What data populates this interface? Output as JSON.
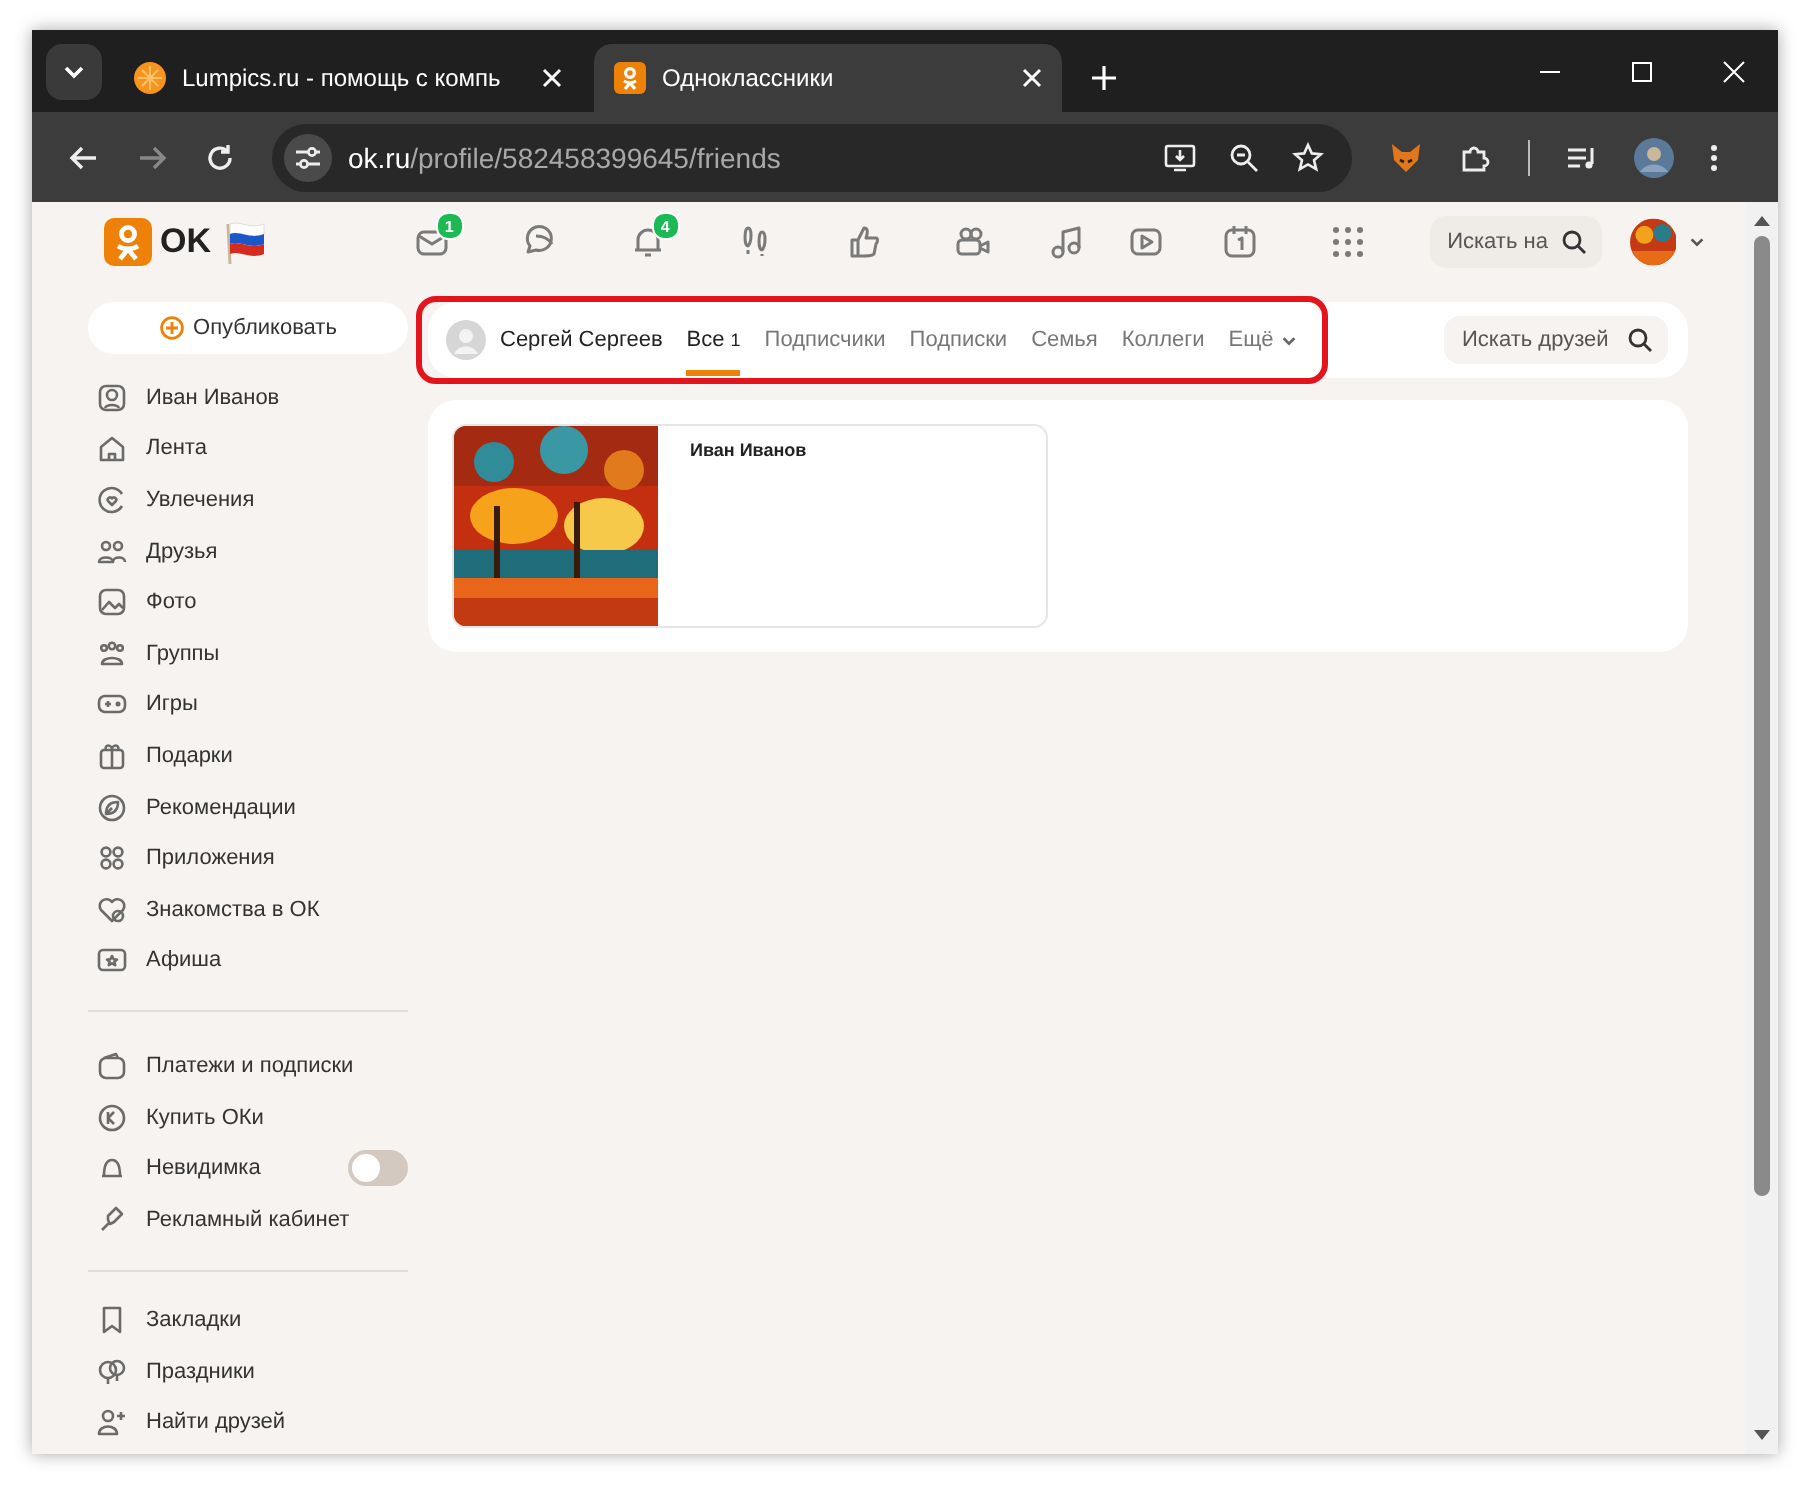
{
  "browser": {
    "tabs": [
      {
        "title": "Lumpics.ru - помощь с компь",
        "selected": false
      },
      {
        "title": "Одноклассники",
        "selected": true
      }
    ],
    "url": {
      "host": "ok.ru",
      "path": "/profile/582458399645/friends"
    }
  },
  "header": {
    "logo": "OK",
    "nav": [
      {
        "kind": "messages",
        "badge": "1"
      },
      {
        "kind": "discussions"
      },
      {
        "kind": "notifications",
        "badge": "4"
      },
      {
        "kind": "guests"
      },
      {
        "kind": "likes"
      },
      {
        "kind": "video"
      },
      {
        "kind": "music"
      },
      {
        "kind": "clips"
      },
      {
        "kind": "events"
      },
      {
        "kind": "apps"
      }
    ],
    "search": {
      "placeholder": "Искать на"
    }
  },
  "publish_button": "Опубликовать",
  "sidebar": [
    {
      "items": [
        {
          "kind": "link",
          "label": "Иван Иванов"
        },
        {
          "kind": "link",
          "label": "Лента"
        },
        {
          "kind": "link",
          "label": "Увлечения"
        },
        {
          "kind": "link",
          "label": "Друзья"
        },
        {
          "kind": "link",
          "label": "Фото"
        },
        {
          "kind": "link",
          "label": "Группы"
        },
        {
          "kind": "link",
          "label": "Игры"
        },
        {
          "kind": "link",
          "label": "Подарки"
        },
        {
          "kind": "link",
          "label": "Рекомендации"
        },
        {
          "kind": "link",
          "label": "Приложения"
        },
        {
          "kind": "link",
          "label": "Знакомства в ОК"
        },
        {
          "kind": "link",
          "label": "Афиша"
        }
      ]
    },
    {
      "items": [
        {
          "kind": "link",
          "label": "Платежи и подписки"
        },
        {
          "kind": "link",
          "label": "Купить ОКи"
        },
        {
          "kind": "toggle",
          "label": "Невидимка",
          "on": false
        },
        {
          "kind": "link",
          "label": "Рекламный кабинет"
        }
      ]
    },
    {
      "items": [
        {
          "kind": "link",
          "label": "Закладки"
        },
        {
          "kind": "link",
          "label": "Праздники"
        },
        {
          "kind": "link",
          "label": "Найти друзей"
        }
      ]
    }
  ],
  "friends_filter": {
    "highlighted": true,
    "user": "Сергей Сергеев",
    "tabs": [
      {
        "label": "Все",
        "count": "1",
        "selected": true
      },
      {
        "label": "Подписчики",
        "selected": false
      },
      {
        "label": "Подписки",
        "selected": false
      },
      {
        "label": "Семья",
        "selected": false
      },
      {
        "label": "Коллеги",
        "selected": false
      }
    ],
    "more": "Ещё",
    "search": {
      "placeholder": "Искать друзей"
    }
  },
  "friends": [
    {
      "name": "Иван Иванов"
    }
  ]
}
